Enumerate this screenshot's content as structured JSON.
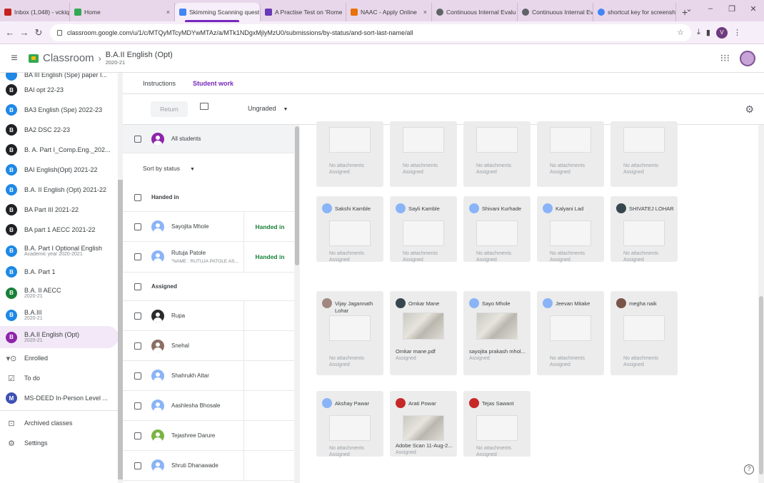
{
  "browser": {
    "tabs": [
      {
        "label": "Inbox (1,048) - vckiqac@",
        "color": "#c5221f"
      },
      {
        "label": "Home",
        "color": "#34a853"
      },
      {
        "label": "Skimming Scanning quest",
        "color": "#4285f4"
      },
      {
        "label": "A Practise Test on 'Rome",
        "color": "#673ab7"
      },
      {
        "label": "NAAC - Apply Online",
        "color": "#e8710a"
      },
      {
        "label": "Continuous Internal Evalu",
        "color": "#5f6368"
      },
      {
        "label": "Continuous Internal Evalu",
        "color": "#5f6368"
      },
      {
        "label": "shortcut key for screensh",
        "color": "#4285f4"
      }
    ],
    "url": "classroom.google.com/u/1/c/MTQyMTcyMDYwMTAz/a/MTk1NDgxMjlyMzU0/submissions/by-status/and-sort-last-name/all"
  },
  "header": {
    "brand": "Classroom",
    "class_title": "B.A.II English (Opt)",
    "class_year": "2020-21"
  },
  "sidebar": {
    "items": [
      {
        "initial": "",
        "label": "BA III English (Spe) paper I...",
        "sub": "",
        "color": "#1e88e5"
      },
      {
        "initial": "B",
        "label": "BAI opt 22-23",
        "sub": "",
        "color": "#202124"
      },
      {
        "initial": "B",
        "label": "BA3 English (Spe) 2022-23",
        "sub": "",
        "color": "#1e88e5"
      },
      {
        "initial": "B",
        "label": "BA2 DSC 22-23",
        "sub": "",
        "color": "#202124"
      },
      {
        "initial": "B",
        "label": "B. A. Part I_Comp.Eng._202...",
        "sub": "",
        "color": "#202124"
      },
      {
        "initial": "B",
        "label": "BAI English(Opt) 2021-22",
        "sub": "",
        "color": "#1e88e5"
      },
      {
        "initial": "B",
        "label": "B.A. II English (Opt) 2021-22",
        "sub": "",
        "color": "#1e88e5"
      },
      {
        "initial": "B",
        "label": "BA Part III 2021-22",
        "sub": "",
        "color": "#202124"
      },
      {
        "initial": "B",
        "label": "BA part 1 AECC 2021-22",
        "sub": "",
        "color": "#202124"
      },
      {
        "initial": "B",
        "label": "B.A. Part I Optional English",
        "sub": "Academic year 2020-2021",
        "color": "#1e88e5"
      },
      {
        "initial": "B",
        "label": "B.A. Part 1",
        "sub": "",
        "color": "#1e88e5"
      },
      {
        "initial": "B",
        "label": "B.A. II AECC",
        "sub": "2020-21",
        "color": "#188038"
      },
      {
        "initial": "B",
        "label": "B.A.III",
        "sub": "2020-21",
        "color": "#1e88e5"
      },
      {
        "initial": "B",
        "label": "B.A.II English (Opt)",
        "sub": "2020-21",
        "color": "#8e24aa"
      }
    ],
    "enrolled": "Enrolled",
    "todo": "To do",
    "msdeed_initial": "M",
    "msdeed": "MS-DEED In-Person Level ...",
    "archived": "Archived classes",
    "settings": "Settings"
  },
  "content_tabs": {
    "instructions": "Instructions",
    "student_work": "Student work"
  },
  "toolbar": {
    "return": "Return",
    "grade_filter": "Ungraded"
  },
  "list": {
    "all_students": "All students",
    "sort": "Sort by status",
    "handed_in_header": "Handed in",
    "assigned_header": "Assigned",
    "handed_in": [
      {
        "name": "Sayojita Mhole",
        "sub": "",
        "status": "Handed in"
      },
      {
        "name": "Rutuja Patole",
        "sub": "\"NAME : RUTUJA PATOLE AS...",
        "status": "Handed in"
      }
    ],
    "assigned": [
      {
        "name": "Rupa"
      },
      {
        "name": "Snehal"
      },
      {
        "name": "Shahrukh Attar"
      },
      {
        "name": "Aashlesha Bhosale"
      },
      {
        "name": "Tejashree Darure"
      },
      {
        "name": "Shruti Dhanawade"
      }
    ]
  },
  "cards": {
    "top_status_1": "No attachments",
    "top_status_2": "Assigned",
    "row2": [
      {
        "name": "Sakshi Kamble",
        "l1": "No attachments",
        "l2": "Assigned"
      },
      {
        "name": "Sayli Kamble",
        "l1": "No attachments",
        "l2": "Assigned"
      },
      {
        "name": "Shivani Kurhade",
        "l1": "No attachments",
        "l2": "Assigned"
      },
      {
        "name": "Kalyani Lad",
        "l1": "No attachments",
        "l2": "Assigned"
      },
      {
        "name": "SHIVATEJ LOHAR",
        "l1": "No attachments",
        "l2": "Assigned"
      }
    ],
    "row3": [
      {
        "name": "Vijay Jagannath Lohar",
        "l1": "No attachments",
        "l2": "Assigned"
      },
      {
        "name": "Omkar Mane",
        "l1": "Omkar mane.pdf",
        "l2": "Assigned"
      },
      {
        "name": "Sayo Mhole",
        "l1": "sayojita prakash mhol...",
        "l2": "Assigned"
      },
      {
        "name": "Jeevan Mitake",
        "l1": "No attachments",
        "l2": "Assigned"
      },
      {
        "name": "megha naik",
        "l1": "No attachments",
        "l2": "Assigned"
      }
    ],
    "row4": [
      {
        "name": "Akshay Pawar",
        "l1": "No attachments",
        "l2": "Assigned"
      },
      {
        "name": "Arati Powar",
        "l1": "Adobe Scan 11-Aug-2...",
        "l2": "Assigned"
      },
      {
        "name": "Tejas Sawant",
        "l1": "No attachments",
        "l2": "Assigned"
      }
    ]
  }
}
